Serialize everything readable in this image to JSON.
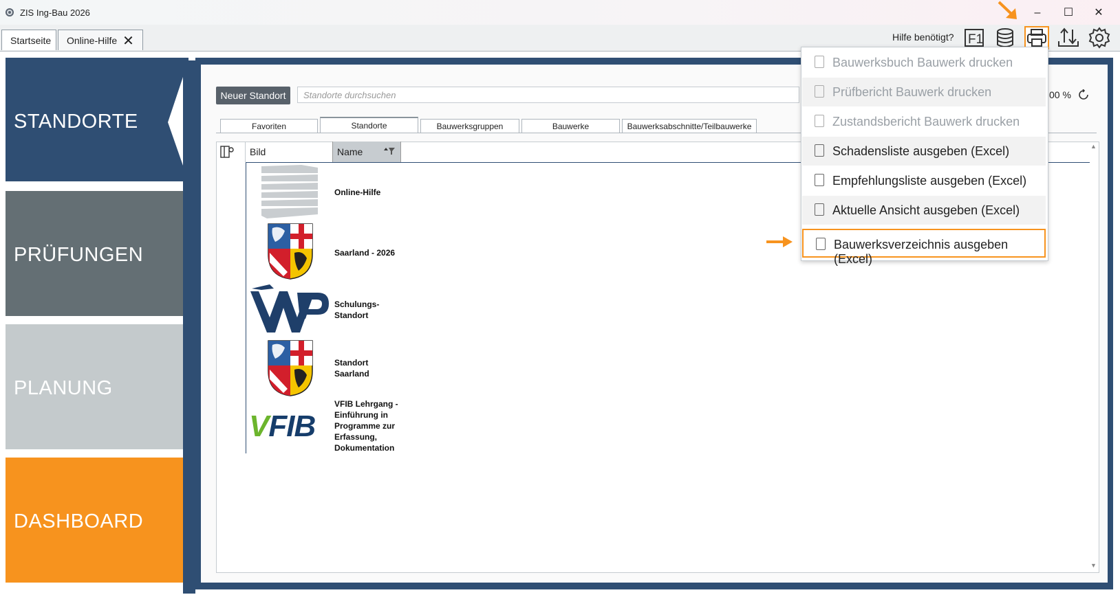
{
  "window": {
    "title": "ZIS Ing-Bau 2026",
    "minimize": "–",
    "maximize": "☐",
    "close": "✕"
  },
  "tabs": [
    {
      "label": "Startseite"
    },
    {
      "label": "Online-Hilfe",
      "close": "✕"
    }
  ],
  "toolbar": {
    "help_text": "Hilfe benötigt?",
    "f1_label": "F1"
  },
  "sidebar": [
    {
      "label": "STANDORTE",
      "color": "#2f4e73"
    },
    {
      "label": "PRÜFUNGEN",
      "color": "#646f74"
    },
    {
      "label": "PLANUNG",
      "color": "#c4cacc"
    },
    {
      "label": "DASHBOARD",
      "color": "#f7931e"
    }
  ],
  "main": {
    "new_button": "Neuer Standort",
    "search_placeholder": "Standorte durchsuchen",
    "zoom": "00 %",
    "subtabs": [
      "Favoriten",
      "Standorte",
      "Bauwerksgruppen",
      "Bauwerke",
      "Bauwerksabschnitte/Teilbauwerke"
    ],
    "active_subtab": "Standorte",
    "columns": [
      "Bild",
      "Name"
    ],
    "rows": [
      {
        "name": "Online-Hilfe",
        "image": "stacked-layers-logo"
      },
      {
        "name": "Saarland - 2026",
        "image": "saarland-coat-of-arms"
      },
      {
        "name": "Schulungs-\nStandort",
        "image": "wmp-logo"
      },
      {
        "name": "Standort\nSaarland",
        "image": "saarland-coat-of-arms"
      },
      {
        "name": "VFIB Lehrgang -\nEinführung in\nProgramme zur\nErfassung,\nDokumentation",
        "image": "vfib-logo"
      }
    ],
    "vfib_logo_text": "VFIB"
  },
  "print_menu": {
    "items": [
      {
        "label": "Bauwerksbuch Bauwerk drucken",
        "enabled": false
      },
      {
        "label": "Prüfbericht Bauwerk drucken",
        "enabled": false
      },
      {
        "label": "Zustandsbericht Bauwerk drucken",
        "enabled": false
      },
      {
        "label": "Schadensliste ausgeben (Excel)",
        "enabled": true
      },
      {
        "label": "Empfehlungsliste ausgeben (Excel)",
        "enabled": true
      },
      {
        "label": "Aktuelle Ansicht ausgeben (Excel)",
        "enabled": true
      },
      {
        "label": "Bauwerksverzeichnis ausgeben (Excel)",
        "enabled": true,
        "highlighted": true
      }
    ]
  },
  "accent_color": "#f7931e"
}
